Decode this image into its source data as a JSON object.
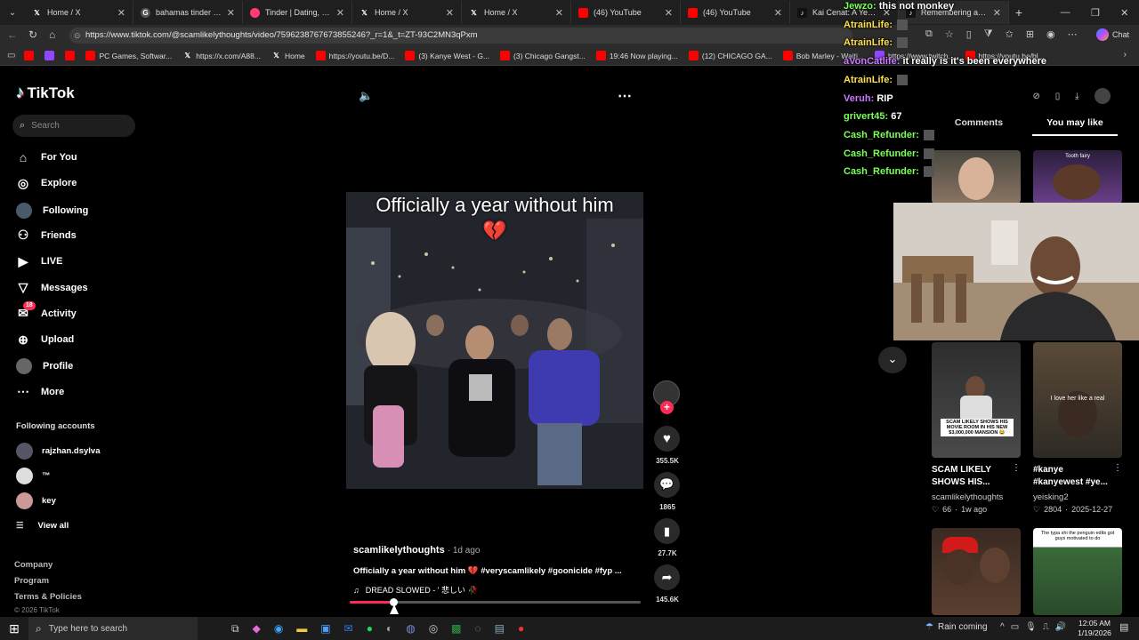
{
  "browser": {
    "tabs": [
      {
        "label": "Home / X",
        "icon": "x-icon"
      },
      {
        "label": "bahamas tinder - Goog",
        "icon": "google-icon"
      },
      {
        "label": "Tinder | Dating, Make Fr",
        "icon": "tinder-icon"
      },
      {
        "label": "Home / X",
        "icon": "x-icon"
      },
      {
        "label": "Home / X",
        "icon": "x-icon"
      },
      {
        "label": "(46) YouTube",
        "icon": "youtube-icon"
      },
      {
        "label": "(46) YouTube",
        "icon": "youtube-icon"
      },
      {
        "label": "Kai Cenat: A Year of Pe",
        "icon": "tiktok-icon"
      },
      {
        "label": "Remembering a Ye",
        "icon": "tiktok-icon"
      }
    ],
    "url": "https://www.tiktok.com/@scamlikelythoughts/video/7596238767673855246?_r=1&_t=ZT-93C2MN3qPxm",
    "bookmarks": [
      {
        "label": "",
        "icon": "youtube-icon"
      },
      {
        "label": "",
        "icon": "twitch-icon"
      },
      {
        "label": "",
        "icon": "youtube-icon"
      },
      {
        "label": "PC Games, Softwar...",
        "icon": "youtube-icon"
      },
      {
        "label": "https://x.com/A88...",
        "icon": "x-icon"
      },
      {
        "label": "Home",
        "icon": "x-icon"
      },
      {
        "label": "https://youtu.be/D...",
        "icon": "youtube-icon"
      },
      {
        "label": "(3) Kanye West - G...",
        "icon": "youtube-icon"
      },
      {
        "label": "(3) Chicago Gangst...",
        "icon": "youtube-icon"
      },
      {
        "label": "19:46 Now playing...",
        "icon": "youtube-icon"
      },
      {
        "label": "(12) CHICAGO GA...",
        "icon": "youtube-icon"
      },
      {
        "label": "Bob Marley - Waiti...",
        "icon": "youtube-icon"
      },
      {
        "label": "https://www.twitch...",
        "icon": "twitch-icon"
      },
      {
        "label": "https://youtu.be/bl...",
        "icon": "youtube-icon"
      }
    ],
    "chat_label": "Chat"
  },
  "tiktok": {
    "logo": "TikTok",
    "search_placeholder": "Search",
    "nav": [
      {
        "label": "For You",
        "icon": "home-icon"
      },
      {
        "label": "Explore",
        "icon": "compass-icon"
      },
      {
        "label": "Following",
        "icon": "following-avatar-icon"
      },
      {
        "label": "Friends",
        "icon": "friends-icon"
      },
      {
        "label": "LIVE",
        "icon": "live-icon"
      },
      {
        "label": "Messages",
        "icon": "messages-icon"
      },
      {
        "label": "Activity",
        "icon": "activity-icon",
        "badge": "18"
      },
      {
        "label": "Upload",
        "icon": "upload-icon"
      },
      {
        "label": "Profile",
        "icon": "profile-icon"
      },
      {
        "label": "More",
        "icon": "more-icon"
      }
    ],
    "following_title": "Following accounts",
    "following": [
      {
        "name": "rajzhan.dsylva"
      },
      {
        "name": "™"
      },
      {
        "name": "key"
      }
    ],
    "view_all": "View all",
    "footer": [
      "Company",
      "Program",
      "Terms & Policies",
      "© 2026 TikTok"
    ],
    "video": {
      "caption_overlay": "Officially a year without him 💔",
      "author": "scamlikelythoughts",
      "age": "· 1d ago",
      "description": "Officially a year without him 💔 #veryscamlikely #goonicide #fyp ...",
      "sound": "DREAD SLOWED - ' 悲しい 🥀",
      "likes": "355.5K",
      "comments": "1865",
      "saves": "27.7K",
      "shares": "145.6K",
      "progress": 0.15
    },
    "right_tabs": [
      "Comments",
      "You may like"
    ],
    "suggestions": [
      {
        "title": "",
        "user": "",
        "meta": "",
        "thumb_text": ""
      },
      {
        "title": "",
        "user": "",
        "meta": "",
        "thumb_text": "Tooth fairy"
      },
      {
        "title": "SCAM LIKELY SHOWS HIS...",
        "user": "scamlikelythoughts",
        "likes": "66",
        "age": "1w ago",
        "thumb_text": "SCAM LIKELY SHOWS HIS MOVIE ROOM IN HIS NEW $3,000,000 MANSION 😂"
      },
      {
        "title": "#kanye #kanyewest #ye...",
        "user": "yeisking2",
        "likes": "2804",
        "age": "2025-12-27",
        "thumb_text": "I love her like a real"
      },
      {
        "title": "",
        "user": "",
        "thumb_text": ""
      },
      {
        "title": "",
        "user": "",
        "thumb_text": "The typa shi the penguin edits got guys motivated to do"
      }
    ]
  },
  "chat": [
    {
      "user": "Jewzo",
      "msg": "this not monkey",
      "color": "#7cff5a"
    },
    {
      "user": "AtrainLife",
      "msg": "",
      "color": "#ffe04b"
    },
    {
      "user": "AtrainLife",
      "msg": "",
      "color": "#ffe04b"
    },
    {
      "user": "aVonCatlife",
      "msg": "it really is it's been everywhere",
      "color": "#c87cff"
    },
    {
      "user": "AtrainLife",
      "msg": "",
      "color": "#ffe04b"
    },
    {
      "user": "Veruh",
      "msg": "RIP",
      "color": "#c87cff"
    },
    {
      "user": "grivert45",
      "msg": "67",
      "color": "#7cff5a"
    },
    {
      "user": "Cash_Refunder",
      "msg": "",
      "color": "#7cff5a"
    },
    {
      "user": "Cash_Refunder",
      "msg": "",
      "color": "#7cff5a"
    },
    {
      "user": "Cash_Refunder",
      "msg": "",
      "color": "#7cff5a"
    }
  ],
  "taskbar": {
    "search_placeholder": "Type here to search",
    "weather": "Rain coming",
    "time": "12:05 AM",
    "date": "1/19/2026"
  },
  "colors": {
    "accent": "#fe2c55",
    "tiktok_bg": "#000000"
  }
}
